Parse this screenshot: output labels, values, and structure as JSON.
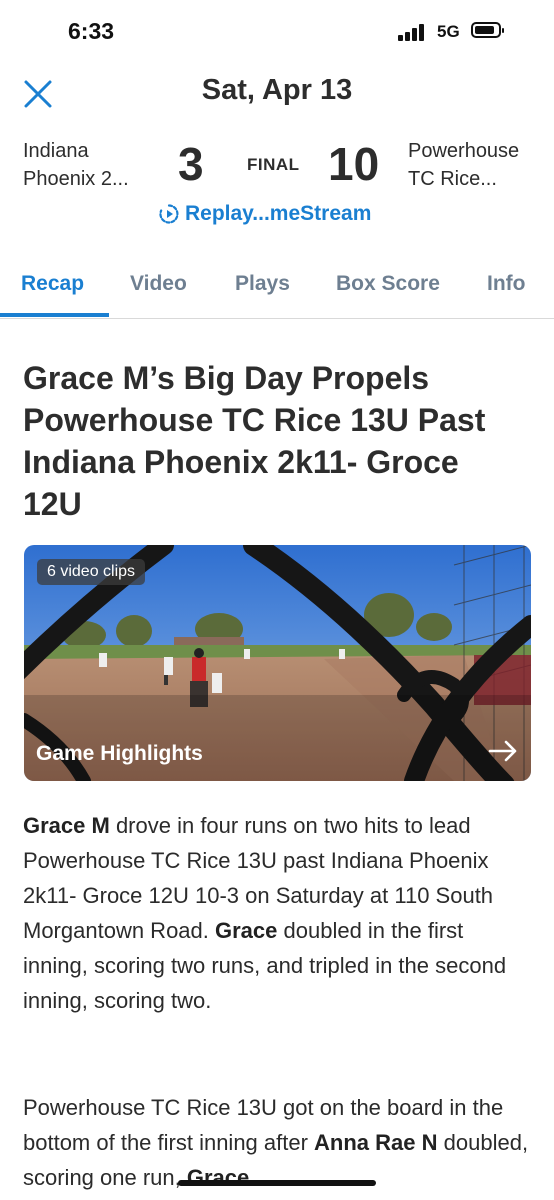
{
  "status_bar": {
    "time": "6:33",
    "network": "5G",
    "battery_level": 0.85
  },
  "header": {
    "date": "Sat, Apr 13",
    "close_icon": "close-icon"
  },
  "game": {
    "home_team": "Indiana Phoenix 2...",
    "home_score": "3",
    "status": "FINAL",
    "away_score": "10",
    "away_team": "Powerhouse TC Rice...",
    "replay_label": "Replay...meStream"
  },
  "tabs": [
    {
      "label": "Recap",
      "active": true
    },
    {
      "label": "Video",
      "active": false
    },
    {
      "label": "Plays",
      "active": false
    },
    {
      "label": "Box Score",
      "active": false
    },
    {
      "label": "Info",
      "active": false
    }
  ],
  "article": {
    "headline": "Grace M’s Big Day Propels Powerhouse TC Rice 13U Past Indiana Phoenix 2k11- Groce 12U",
    "video": {
      "badge": "6 video clips",
      "title": "Game Highlights"
    },
    "paragraph1": {
      "bold1": "Grace M",
      "text1": " drove in four runs on two hits to lead Powerhouse TC Rice 13U past Indiana Phoenix 2k11- Groce 12U 10-3 on Saturday at 110 South Morgantown Road. ",
      "bold2": "Grace",
      "text2": " doubled in the first inning, scoring two runs, and tripled in the second inning, scoring two."
    },
    "paragraph2": {
      "text1": "Powerhouse TC Rice 13U got on the board in the bottom of the first inning after ",
      "bold1": "Anna Rae N",
      "text2": " doubled, scoring one run, ",
      "bold2": "Grace"
    }
  },
  "colors": {
    "accent": "#1a7fd1",
    "tab_inactive": "#6e7f91",
    "text": "#2d2d2d"
  }
}
